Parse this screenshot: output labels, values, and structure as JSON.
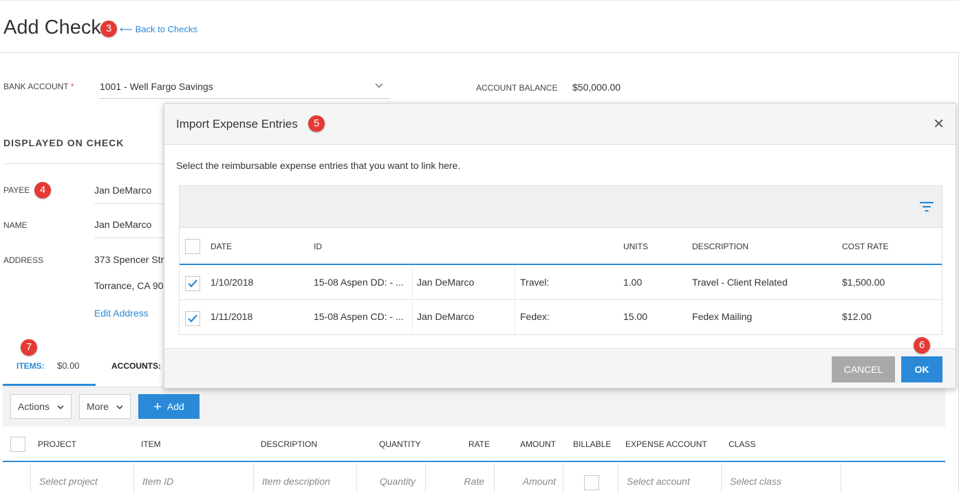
{
  "header": {
    "title": "Add Check",
    "back_arrow": "⟵",
    "back_link": "Back to Checks"
  },
  "badges": {
    "b3": "3",
    "b4": "4",
    "b5": "5",
    "b6": "6",
    "b7": "7"
  },
  "bank": {
    "label": "BANK ACCOUNT",
    "required_mark": "*",
    "value": "1001 - Well Fargo Savings",
    "balance_label": "ACCOUNT BALANCE",
    "balance_value": "$50,000.00"
  },
  "displayed_on_check": {
    "section_title": "DISPLAYED ON CHECK",
    "payee_label": "PAYEE",
    "payee_value": "Jan DeMarco",
    "name_label": "NAME",
    "name_value": "Jan DeMarco",
    "address_label": "ADDRESS",
    "address_line1": "373 Spencer Str",
    "address_line2": "Torrance, CA 90",
    "edit_address": "Edit Address"
  },
  "tabs": {
    "items_label": "ITEMS:",
    "items_value": "$0.00",
    "accounts_label": "ACCOUNTS:"
  },
  "toolbar": {
    "actions": "Actions",
    "more": "More",
    "add": "Add"
  },
  "items_grid": {
    "headers": [
      "PROJECT",
      "ITEM",
      "DESCRIPTION",
      "QUANTITY",
      "RATE",
      "AMOUNT",
      "BILLABLE",
      "EXPENSE ACCOUNT",
      "CLASS"
    ],
    "placeholders": [
      "Select project",
      "Item ID",
      "Item description",
      "Quantity",
      "Rate",
      "Amount",
      "",
      "Select account",
      "Select class"
    ]
  },
  "modal": {
    "title": "Import Expense Entries",
    "close": "✕",
    "instructions": "Select the reimbursable expense entries that you want to link here.",
    "headers": [
      "DATE",
      "ID",
      "UNITS",
      "DESCRIPTION",
      "COST RATE"
    ],
    "rows": [
      {
        "checked": true,
        "date": "1/10/2018",
        "id": "15-08 Aspen DD: - ...",
        "employee": "Jan DeMarco",
        "type": "Travel:",
        "units": "1.00",
        "description": "Travel - Client Related",
        "cost_rate": "$1,500.00"
      },
      {
        "checked": true,
        "date": "1/11/2018",
        "id": "15-08 Aspen CD: - ...",
        "employee": "Jan DeMarco",
        "type": "Fedex:",
        "units": "15.00",
        "description": "Fedex Mailing",
        "cost_rate": "$12.00"
      }
    ],
    "cancel": "CANCEL",
    "ok": "OK"
  },
  "colors": {
    "accent": "#2a8ad8",
    "badge": "#e53935",
    "cancel_bg": "#a9a9a9"
  }
}
